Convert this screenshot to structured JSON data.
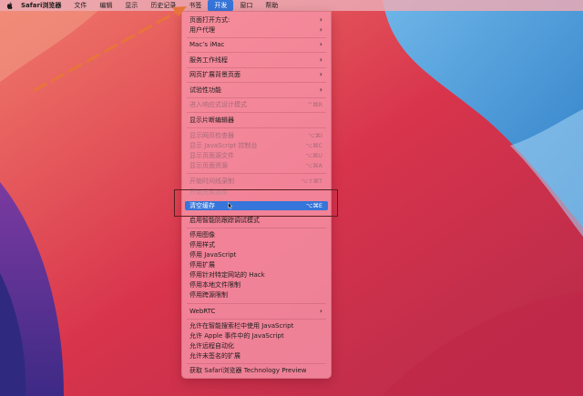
{
  "menubar": {
    "app": "Safari浏览器",
    "items": [
      "文件",
      "编辑",
      "显示",
      "历史记录",
      "书签",
      "开发",
      "窗口",
      "帮助"
    ],
    "active_index": 5
  },
  "menu": {
    "items": [
      {
        "label": "页面打开方式:",
        "shortcut": "",
        "submenu": true,
        "state": "normal"
      },
      {
        "label": "用户代理",
        "shortcut": "",
        "submenu": true,
        "state": "normal"
      },
      {
        "label": "Mac’s iMac",
        "shortcut": "",
        "submenu": true,
        "state": "normal"
      },
      {
        "label": "服务工作线程",
        "shortcut": "",
        "submenu": true,
        "state": "normal"
      },
      {
        "label": "网页扩展背景页面",
        "shortcut": "",
        "submenu": true,
        "state": "normal"
      },
      {
        "label": "试验性功能",
        "shortcut": "",
        "submenu": true,
        "state": "normal"
      },
      {
        "label": "进入响应式设计模式",
        "shortcut": "^⌘R",
        "submenu": false,
        "state": "disabled"
      },
      {
        "label": "显示片断编辑器",
        "shortcut": "",
        "submenu": false,
        "state": "normal"
      },
      {
        "label": "显示网页检查器",
        "shortcut": "⌥⌘I",
        "submenu": false,
        "state": "disabled"
      },
      {
        "label": "显示 JavaScript 控制台",
        "shortcut": "⌥⌘C",
        "submenu": false,
        "state": "disabled"
      },
      {
        "label": "显示页面源文件",
        "shortcut": "⌥⌘U",
        "submenu": false,
        "state": "disabled"
      },
      {
        "label": "显示页面资源",
        "shortcut": "⌥⌘A",
        "submenu": false,
        "state": "disabled"
      },
      {
        "label": "开始时间线录制",
        "shortcut": "⌥⇧⌘T",
        "submenu": false,
        "state": "disabled"
      },
      {
        "label": "开始元素选择",
        "shortcut": "",
        "submenu": false,
        "state": "faint"
      },
      {
        "label": "清空缓存",
        "shortcut": "⌥⌘E",
        "submenu": false,
        "state": "selected"
      },
      {
        "label": "启用智能防跟踪调试模式",
        "shortcut": "",
        "submenu": false,
        "state": "normal"
      },
      {
        "label": "停用图像",
        "shortcut": "",
        "submenu": false,
        "state": "normal"
      },
      {
        "label": "停用样式",
        "shortcut": "",
        "submenu": false,
        "state": "normal"
      },
      {
        "label": "停用 JavaScript",
        "shortcut": "",
        "submenu": false,
        "state": "normal"
      },
      {
        "label": "停用扩展",
        "shortcut": "",
        "submenu": false,
        "state": "normal"
      },
      {
        "label": "停用针对特定网站的 Hack",
        "shortcut": "",
        "submenu": false,
        "state": "normal"
      },
      {
        "label": "停用本地文件限制",
        "shortcut": "",
        "submenu": false,
        "state": "normal"
      },
      {
        "label": "停用跨源限制",
        "shortcut": "",
        "submenu": false,
        "state": "normal"
      },
      {
        "label": "WebRTC",
        "shortcut": "",
        "submenu": true,
        "state": "normal"
      },
      {
        "label": "允许在智能搜索栏中使用 JavaScript",
        "shortcut": "",
        "submenu": false,
        "state": "normal"
      },
      {
        "label": "允许 Apple 事件中的 JavaScript",
        "shortcut": "",
        "submenu": false,
        "state": "normal"
      },
      {
        "label": "允许远程自动化",
        "shortcut": "",
        "submenu": false,
        "state": "normal"
      },
      {
        "label": "允许未签名的扩展",
        "shortcut": "",
        "submenu": false,
        "state": "normal"
      },
      {
        "label": "获取 Safari浏览器 Technology Preview",
        "shortcut": "",
        "submenu": false,
        "state": "normal"
      }
    ]
  },
  "colors": {
    "menu_selected": "#3675d9",
    "annotation_arrow": "#e8743b",
    "annotation_box": "#5a1e1e"
  },
  "icons": {
    "apple": "apple-logo-icon",
    "submenu": "chevron-right-icon",
    "pointer": "mouse-pointer-icon",
    "annotation": "dashed-arrow-icon"
  }
}
